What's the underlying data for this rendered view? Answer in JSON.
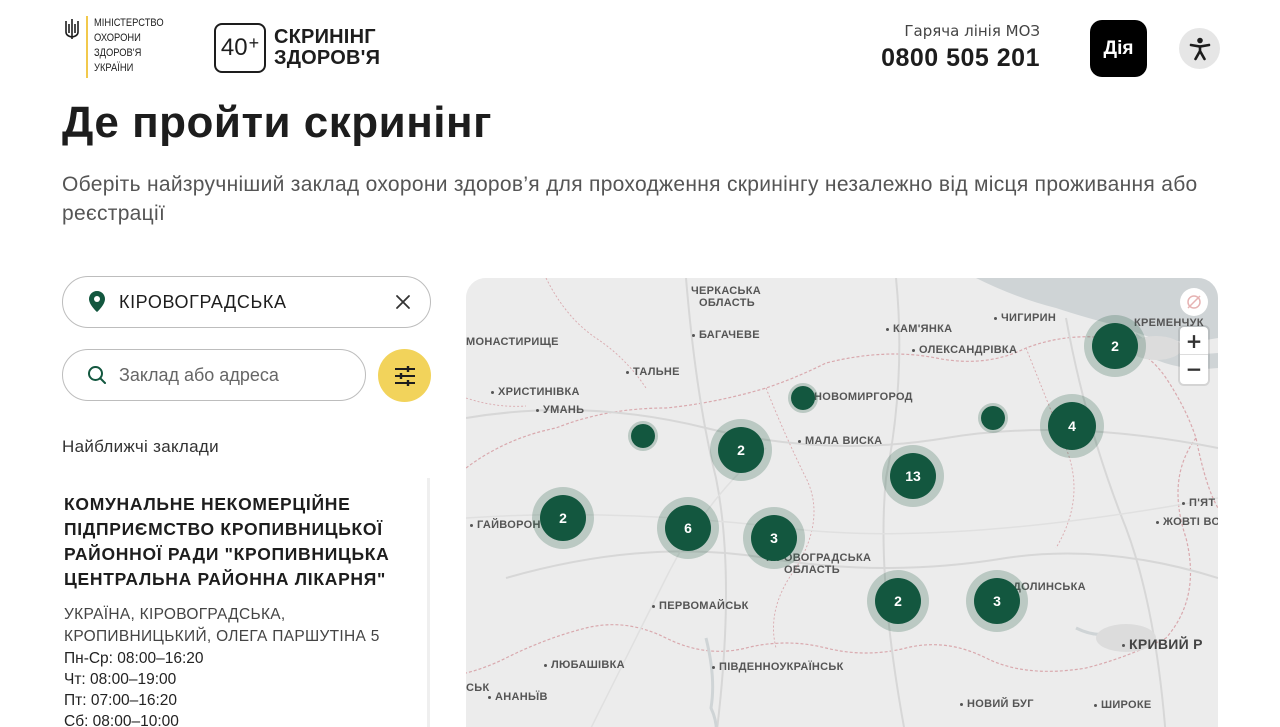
{
  "header": {
    "moz_logo_text": "МІНІСТЕРСТВО ОХОРОНИ ЗДОРОВ'Я УКРАЇНИ",
    "screening_number": "40",
    "screening_plus": "+",
    "screening_line1": "СКРИНІНГ",
    "screening_line2": "ЗДОРОВ'Я",
    "hotline_label": "Гаряча лінія МОЗ",
    "hotline_number": "0800 505 201",
    "diia_label": "Дія"
  },
  "page": {
    "title": "Де пройти скринінг",
    "subtitle": "Оберіть найзручніший заклад охорони здоров’я для проходження скринінгу незалежно від місця проживання або реєстрації"
  },
  "filters": {
    "region_value": "КІРОВОГРАДСЬКА",
    "search_placeholder": "Заклад або адреса",
    "search_value": ""
  },
  "nearest_label": "Найближчі заклади",
  "facilities": [
    {
      "name": "КОМУНАЛЬНЕ НЕКОМЕРЦІЙНЕ ПІДПРИЄМСТВО КРОПИВНИЦЬКОЇ РАЙОННОЇ РАДИ \"КРОПИВНИЦЬКА ЦЕНТРАЛЬНА РАЙОННА ЛІКАРНЯ\"",
      "address": "УКРАЇНА, КІРОВОГРАДСЬКА, КРОПИВНИЦЬКИЙ, ОЛЕГА ПАРШУТІНА 5",
      "hours": [
        "Пн-Ср: 08:00–16:20",
        "Чт: 08:00–19:00",
        "Пт: 07:00–16:20",
        "Сб: 08:00–10:00"
      ]
    }
  ],
  "map": {
    "cities": [
      {
        "label": "ЧЕРКАСЬКА",
        "id": "c1"
      },
      {
        "label": "ОБЛАСТЬ",
        "id": "c2"
      },
      {
        "label": "БАГАЧЕВЕ",
        "id": "c3"
      },
      {
        "label": "КАМ'ЯНКА",
        "id": "c4"
      },
      {
        "label": "ЧИГИРИН",
        "id": "c5"
      },
      {
        "label": "КРЕМЕНЧУК",
        "id": "c6"
      },
      {
        "label": "МОНАСТИРИЩЕ",
        "id": "c7"
      },
      {
        "label": "ОЛЕКСАНДРІВКА",
        "id": "c8"
      },
      {
        "label": "ТАЛЬНЕ",
        "id": "c9"
      },
      {
        "label": "ХРИСТИНІВКА",
        "id": "c10"
      },
      {
        "label": "УМАНЬ",
        "id": "c11"
      },
      {
        "label": "НОВОМИРГОРОД",
        "id": "c12"
      },
      {
        "label": "МАЛА ВИСКА",
        "id": "c13"
      },
      {
        "label": "П'ЯТ",
        "id": "c14"
      },
      {
        "label": "ГАЙВОРОН",
        "id": "c15"
      },
      {
        "label": "ЖОВТІ ВОД",
        "id": "c16"
      },
      {
        "label": "КІРОВОГРАДСЬКА",
        "id": "c17"
      },
      {
        "label": "ОБЛАСТЬ",
        "id": "c18"
      },
      {
        "label": "ДОЛИНСЬКА",
        "id": "c19"
      },
      {
        "label": "ПЕРВОМАЙСЬК",
        "id": "c20"
      },
      {
        "label": "КРИВИЙ Р",
        "id": "c21"
      },
      {
        "label": "ЛЮБАШІВКА",
        "id": "c22"
      },
      {
        "label": "ПІВДЕННОУКРАЇНСЬК",
        "id": "c23"
      },
      {
        "label": "СЬК",
        "id": "c24"
      },
      {
        "label": "АНАНЬЇВ",
        "id": "c25"
      },
      {
        "label": "НОВИЙ БУГ",
        "id": "c26"
      },
      {
        "label": "ШИРОКЕ",
        "id": "c27"
      }
    ],
    "clusters": [
      {
        "count": "2",
        "id": "k1"
      },
      {
        "count": "",
        "id": "k2"
      },
      {
        "count": "",
        "id": "k3"
      },
      {
        "count": "2",
        "id": "k4"
      },
      {
        "count": "",
        "id": "k5"
      },
      {
        "count": "4",
        "id": "k6"
      },
      {
        "count": "13",
        "id": "k7"
      },
      {
        "count": "2",
        "id": "k8"
      },
      {
        "count": "6",
        "id": "k9"
      },
      {
        "count": "3",
        "id": "k10"
      },
      {
        "count": "2",
        "id": "k11"
      },
      {
        "count": "3",
        "id": "k12"
      }
    ],
    "zoom_in": "+",
    "zoom_out": "−"
  }
}
